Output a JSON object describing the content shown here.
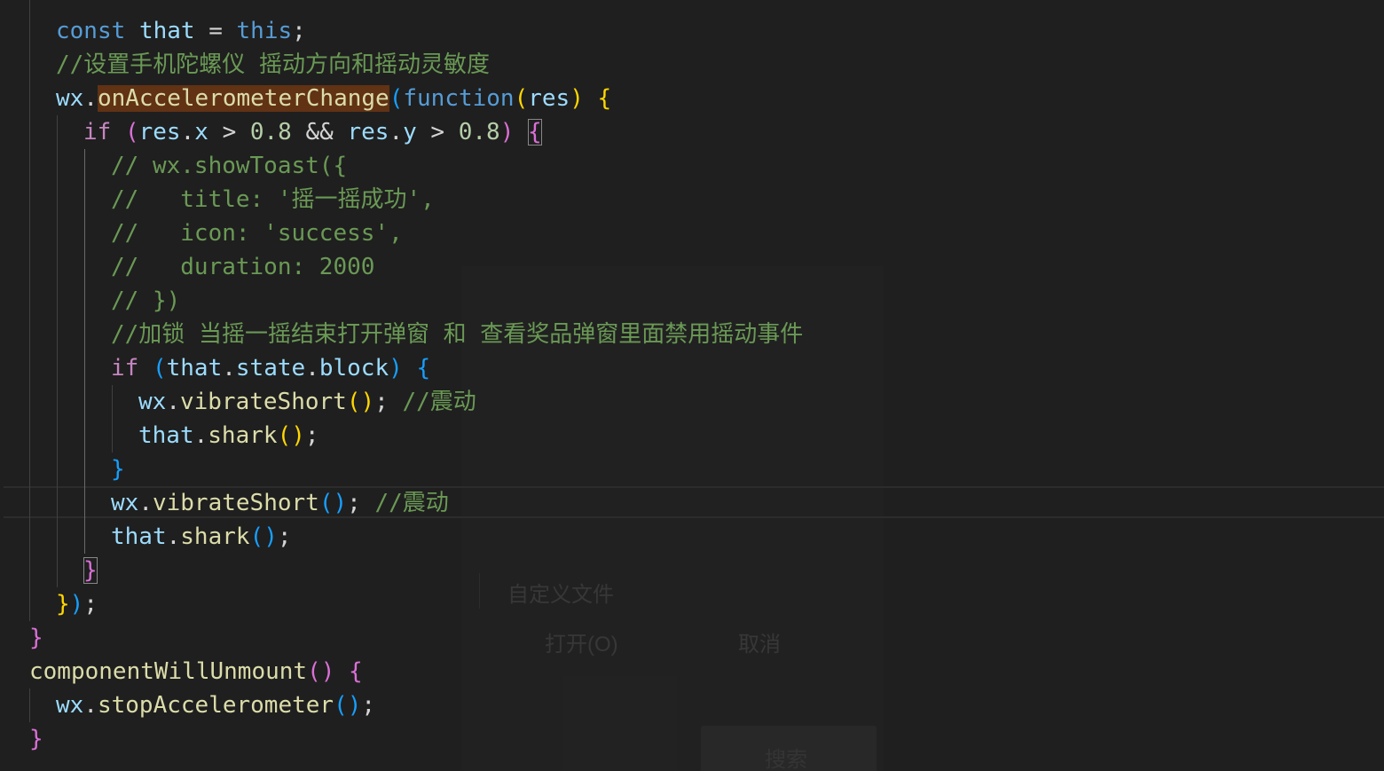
{
  "code": {
    "line1": {
      "kw": "const",
      "name": "that",
      "eq": "=",
      "this": "this",
      "semi": ";"
    },
    "line2": {
      "comment": "//设置手机陀螺仪 摇动方向和摇动灵敏度"
    },
    "line3": {
      "obj": "wx",
      "dot": ".",
      "method": "onAccelerometerChange",
      "open": "(",
      "fnkw": "function",
      "p_open": "(",
      "param": "res",
      "p_close": ")",
      "brace": "{"
    },
    "line4": {
      "kw": "if",
      "open": "(",
      "a": "res",
      "dot1": ".",
      "ax": "x",
      "gt1": ">",
      "n1": "0.8",
      "and": "&&",
      "b": "res",
      "dot2": ".",
      "by": "y",
      "gt2": ">",
      "n2": "0.8",
      "close": ")",
      "brace": "{"
    },
    "line5": {
      "comment": "// wx.showToast({"
    },
    "line6": {
      "comment": "//   title: '摇一摇成功',"
    },
    "line7": {
      "comment": "//   icon: 'success',"
    },
    "line8": {
      "comment": "//   duration: 2000"
    },
    "line9": {
      "comment": "// })"
    },
    "line10": {
      "comment": "//加锁 当摇一摇结束打开弹窗 和 查看奖品弹窗里面禁用摇动事件"
    },
    "line11": {
      "kw": "if",
      "open": "(",
      "a": "that",
      "dot1": ".",
      "b": "state",
      "dot2": ".",
      "c": "block",
      "close": ")",
      "brace": "{"
    },
    "line12": {
      "obj": "wx",
      "dot": ".",
      "method": "vibrateShort",
      "parens": "()",
      "semi": ";",
      "comment": "//震动"
    },
    "line13": {
      "obj": "that",
      "dot": ".",
      "method": "shark",
      "parens": "()",
      "semi": ";"
    },
    "line14": {
      "brace": "}"
    },
    "line15": {
      "obj": "wx",
      "dot": ".",
      "method": "vibrateShort",
      "parens": "()",
      "semi": ";",
      "comment": "//震动"
    },
    "line16": {
      "obj": "that",
      "dot": ".",
      "method": "shark",
      "parens": "()",
      "semi": ";"
    },
    "line17": {
      "brace": "}"
    },
    "line18": {
      "brace": "}",
      "paren": ")",
      "semi": ";"
    },
    "line19": {
      "brace": "}"
    },
    "line20": {
      "method": "componentWillUnmount",
      "parens": "()",
      "brace": "{"
    },
    "line21": {
      "obj": "wx",
      "dot": ".",
      "method": "stopAccelerometer",
      "parens": "()",
      "semi": ";"
    },
    "line22": {
      "brace": "}"
    }
  },
  "ghost_dialog": {
    "file_type": "自定义文件",
    "open_button": "打开(O)",
    "cancel_button": "取消",
    "bottom_button": "搜索"
  },
  "colors": {
    "background": "#1f1f1f",
    "keyword": "#569cd6",
    "control": "#c586c0",
    "variable": "#9cdcfe",
    "function": "#dcdcaa",
    "number": "#b5cea8",
    "comment": "#6a9955",
    "bracket_gold": "#ffd700",
    "bracket_purple": "#da70d6",
    "bracket_blue": "#179fff",
    "highlight": "#613214"
  }
}
